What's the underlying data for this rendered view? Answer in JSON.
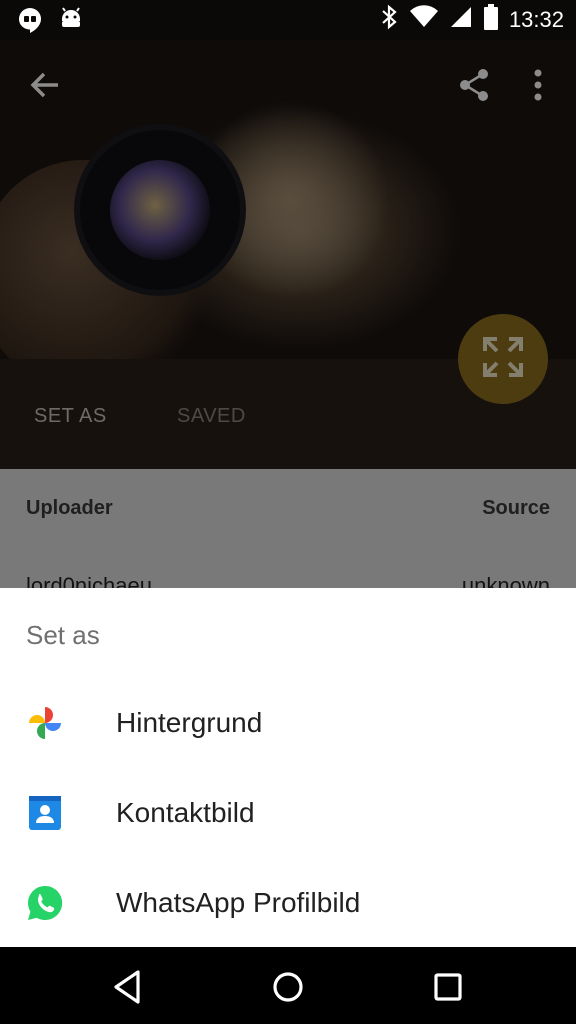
{
  "status_bar": {
    "time": "13:32",
    "left_icons": [
      "hangouts-icon",
      "android-debug-icon"
    ],
    "right_icons": [
      "bluetooth-icon",
      "wifi-icon",
      "signal-icon",
      "battery-icon"
    ]
  },
  "background_app": {
    "toolbar_icons": [
      "back-arrow-icon",
      "share-icon",
      "overflow-menu-icon"
    ],
    "tabs": [
      {
        "label": "SET AS"
      },
      {
        "label": "SAVED"
      }
    ],
    "fab_icon": "fullscreen-icon",
    "info": {
      "uploader_label": "Uploader",
      "source_label": "Source",
      "uploader_value": "lord0nichaeu",
      "source_value": "unknown"
    }
  },
  "sheet": {
    "title": "Set as",
    "options": [
      {
        "label": "Hintergrund",
        "icon": "google-photos-icon"
      },
      {
        "label": "Kontaktbild",
        "icon": "contacts-icon"
      },
      {
        "label": "WhatsApp Profilbild",
        "icon": "whatsapp-icon"
      }
    ]
  },
  "nav_bar": {
    "icons": [
      "back-nav-icon",
      "home-nav-icon",
      "recents-nav-icon"
    ]
  },
  "colors": {
    "scrim": "#000000",
    "fab": "#8a6e1e",
    "sheet_bg": "#ffffff",
    "tab_bg": "#2b201a",
    "whatsapp_green": "#25d366",
    "contacts_blue": "#1e88e5"
  }
}
